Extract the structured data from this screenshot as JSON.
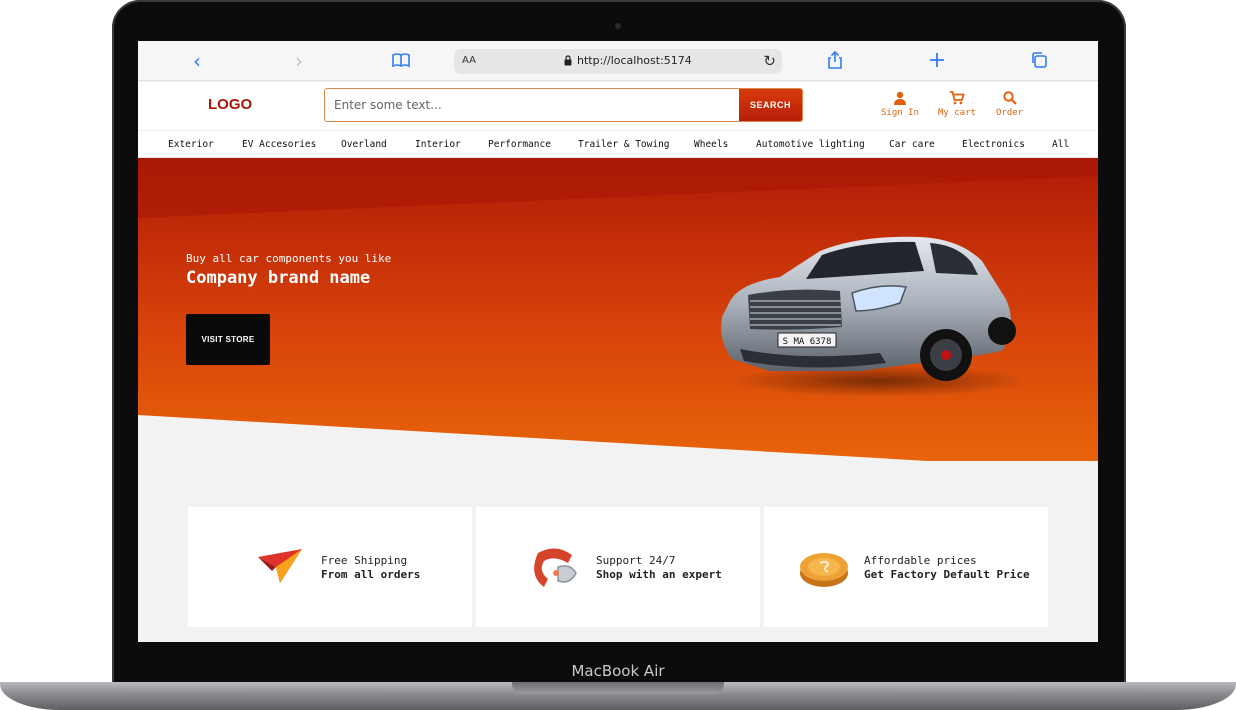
{
  "device": {
    "label": "MacBook Air"
  },
  "browser": {
    "text_size_label": "AA",
    "url": "http://localhost:5174"
  },
  "header": {
    "logo": "LOGO",
    "search": {
      "placeholder": "Enter some text...",
      "button_label": "SEARCH"
    },
    "actions": [
      {
        "label": "Sign In",
        "icon": "person-icon"
      },
      {
        "label": "My cart",
        "icon": "cart-icon"
      },
      {
        "label": "Order",
        "icon": "search-icon"
      }
    ]
  },
  "categories": [
    "Exterior",
    "EV Accesories",
    "Overland",
    "Interior",
    "Performance",
    "Trailer & Towing",
    "Wheels",
    "Automotive lighting",
    "Car care",
    "Electronics",
    "All"
  ],
  "hero": {
    "subtitle": "Buy all car components you like",
    "title": "Company brand name",
    "button_label": "VISIT STORE",
    "plate_text": "S MA 6378"
  },
  "features": [
    {
      "line1": "Free Shipping",
      "line2": "From all orders",
      "icon": "paper-plane-icon"
    },
    {
      "line1": "Support 24/7",
      "line2": "Shop with an expert",
      "icon": "phone-icon"
    },
    {
      "line1": "Affordable prices",
      "line2": "Get Factory Default Price",
      "icon": "coin-icon"
    }
  ],
  "colors": {
    "accent": "#e2620c",
    "logo": "#a8170a",
    "hero_top": "#b01a07",
    "hero_bottom": "#e8640a",
    "browser_blue": "#2f7cf6"
  }
}
